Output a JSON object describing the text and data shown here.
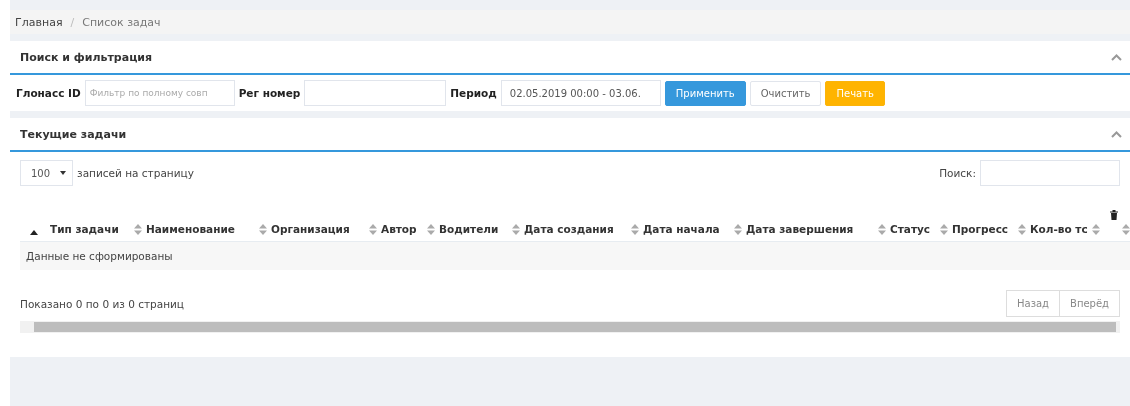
{
  "breadcrumb": [
    {
      "label": "Главная",
      "current": false
    },
    {
      "label": "Список задач",
      "current": true
    }
  ],
  "breadcrumb_separator": "/",
  "filter_panel": {
    "title": "Поиск и фильтрация",
    "expanded": true,
    "fields": [
      {
        "label": "Глонасс ID",
        "placeholder": "Фильтр по полному совп"
      },
      {
        "label": "Рег номер"
      },
      {
        "label": "Период",
        "value": "02.05.2019 00:00 - 03.06."
      }
    ],
    "buttons": [
      {
        "label": "Применить",
        "kind": "primary"
      },
      {
        "label": "Очистить",
        "kind": "default"
      },
      {
        "label": "Печать",
        "kind": "warning"
      }
    ]
  },
  "tasks_panel": {
    "title": "Текущие задачи",
    "expanded": true,
    "page_size": "100",
    "page_size_label": "записей на страницу",
    "search_label": "Поиск:",
    "table": {
      "columns": [
        {
          "sorted": true
        },
        {
          "label": "Тип задачи",
          "sorted": false
        },
        {
          "label": "Наименование",
          "sorted": false
        },
        {
          "label": "Организация",
          "sorted": false
        },
        {
          "label": "Автор",
          "sorted": false
        },
        {
          "label": "Водители",
          "sorted": false
        },
        {
          "label": "Дата создания",
          "sorted": false
        },
        {
          "label": "Дата начала",
          "sorted": false
        },
        {
          "label": "Дата завершения",
          "sorted": false
        },
        {
          "label": "Статус",
          "sorted": false
        },
        {
          "label": "Прогресс",
          "sorted": false
        },
        {
          "label": "Кол-во тс",
          "sorted": false
        },
        {
          "kind": "delete",
          "sorted": false
        }
      ],
      "empty_message": "Данные не сформированы"
    },
    "info": "Показано 0 по 0 из 0 страниц",
    "pager": [
      {
        "label": "Назад",
        "disabled": true
      },
      {
        "label": "Вперёд",
        "disabled": true
      }
    ]
  }
}
